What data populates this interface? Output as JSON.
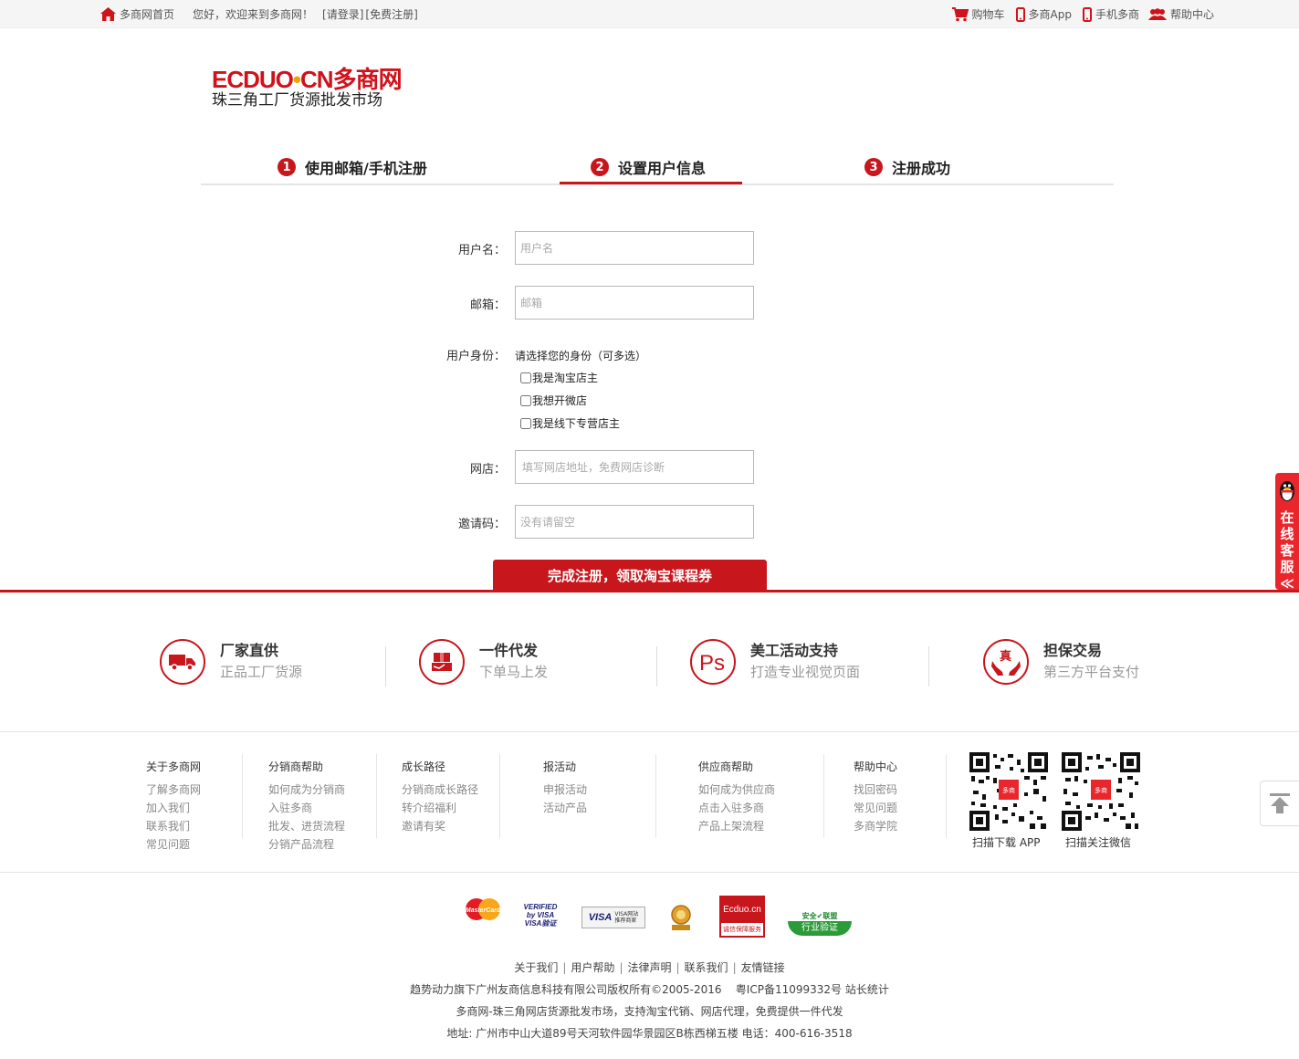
{
  "topbar": {
    "home": "多商网首页",
    "welcome": "您好，欢迎来到多商网！",
    "login": "[请登录]",
    "register": "[免费注册]",
    "cart": "购物车",
    "app": "多商App",
    "mobile": "手机多商",
    "help": "帮助中心"
  },
  "logo": {
    "brand": "ECDUO",
    "brand_dot": "•",
    "brand_tail": "CN多商网",
    "tagline": "珠三角工厂货源批发市场"
  },
  "steps": [
    {
      "num": "1",
      "label": "使用邮箱/手机注册"
    },
    {
      "num": "2",
      "label": "设置用户信息"
    },
    {
      "num": "3",
      "label": "注册成功"
    }
  ],
  "form": {
    "username_label": "用户名：",
    "username_placeholder": "用户名",
    "email_label": "邮箱：",
    "email_placeholder": "邮箱",
    "role_label": "用户身份：",
    "role_hint": "请选择您的身份（可多选）",
    "roles": [
      "我是淘宝店主",
      "我想开微店",
      "我是线下专营店主"
    ],
    "shop_label": "网店：",
    "shop_placeholder": "填写网店地址，免费网店诊断",
    "invite_label": "邀请码：",
    "invite_placeholder": "没有请留空",
    "submit": "完成注册，领取淘宝课程券"
  },
  "service_tab": {
    "chars": [
      "在",
      "线",
      "客",
      "服",
      "≪"
    ]
  },
  "features": [
    {
      "title": "厂家直供",
      "sub": "正品工厂货源",
      "icon": "truck-icon"
    },
    {
      "title": "一件代发",
      "sub": "下单马上发",
      "icon": "package-icon"
    },
    {
      "title": "美工活动支持",
      "sub": "打造专业视觉页面",
      "icon": "ps-icon"
    },
    {
      "title": "担保交易",
      "sub": "第三方平台支付",
      "icon": "guarantee-icon",
      "icon_text": "真"
    }
  ],
  "footer_cols": [
    {
      "title": "关于多商网",
      "links": [
        "了解多商网",
        "加入我们",
        "联系我们",
        "常见问题"
      ]
    },
    {
      "title": "分销商帮助",
      "links": [
        "如何成为分销商",
        "入驻多商",
        "批发、进货流程",
        "分销产品流程"
      ]
    },
    {
      "title": "成长路径",
      "links": [
        "分销商成长路径",
        "转介绍福利",
        "邀请有奖"
      ]
    },
    {
      "title": "报活动",
      "links": [
        "申报活动",
        "活动产品"
      ]
    },
    {
      "title": "供应商帮助",
      "links": [
        "如何成为供应商",
        "点击入驻多商",
        "产品上架流程"
      ]
    },
    {
      "title": "帮助中心",
      "links": [
        "找回密码",
        "常见问题",
        "多商学院"
      ]
    }
  ],
  "qr": {
    "app_label": "扫描下载 APP",
    "wechat_label": "扫描关注微信",
    "logo_text": "多商"
  },
  "badges": {
    "mastercard": "MasterCard",
    "verified_visa_1": "VERIFIED",
    "verified_visa_2": "by VISA",
    "verified_visa_3": "VISA验证",
    "visa_site_1": "VISA",
    "visa_site_2": "VISA网站",
    "visa_site_3": "推荐商家",
    "ecduo_1": "Ecduo.cn",
    "ecduo_2": "诚信保障服务",
    "safe_1": "安全✔联盟",
    "safe_2": "行业验证"
  },
  "bottom": {
    "links": [
      "关于我们",
      "用户帮助",
      "法律声明",
      "联系我们",
      "友情链接"
    ],
    "copyright": "趋势动力旗下广州友商信息科技有限公司版权所有©2005-2016    粤ICP备11099332号 站长统计",
    "slogan": "多商网-珠三角网店货源批发市场，支持淘宝代销、网店代理，免费提供一件代发",
    "address": "地址: 广州市中山大道89号天河软件园华景园区B栋西梯五楼 电话：400-616-3518"
  },
  "colors": {
    "accent": "#c8161d",
    "gray_text": "#999999"
  }
}
